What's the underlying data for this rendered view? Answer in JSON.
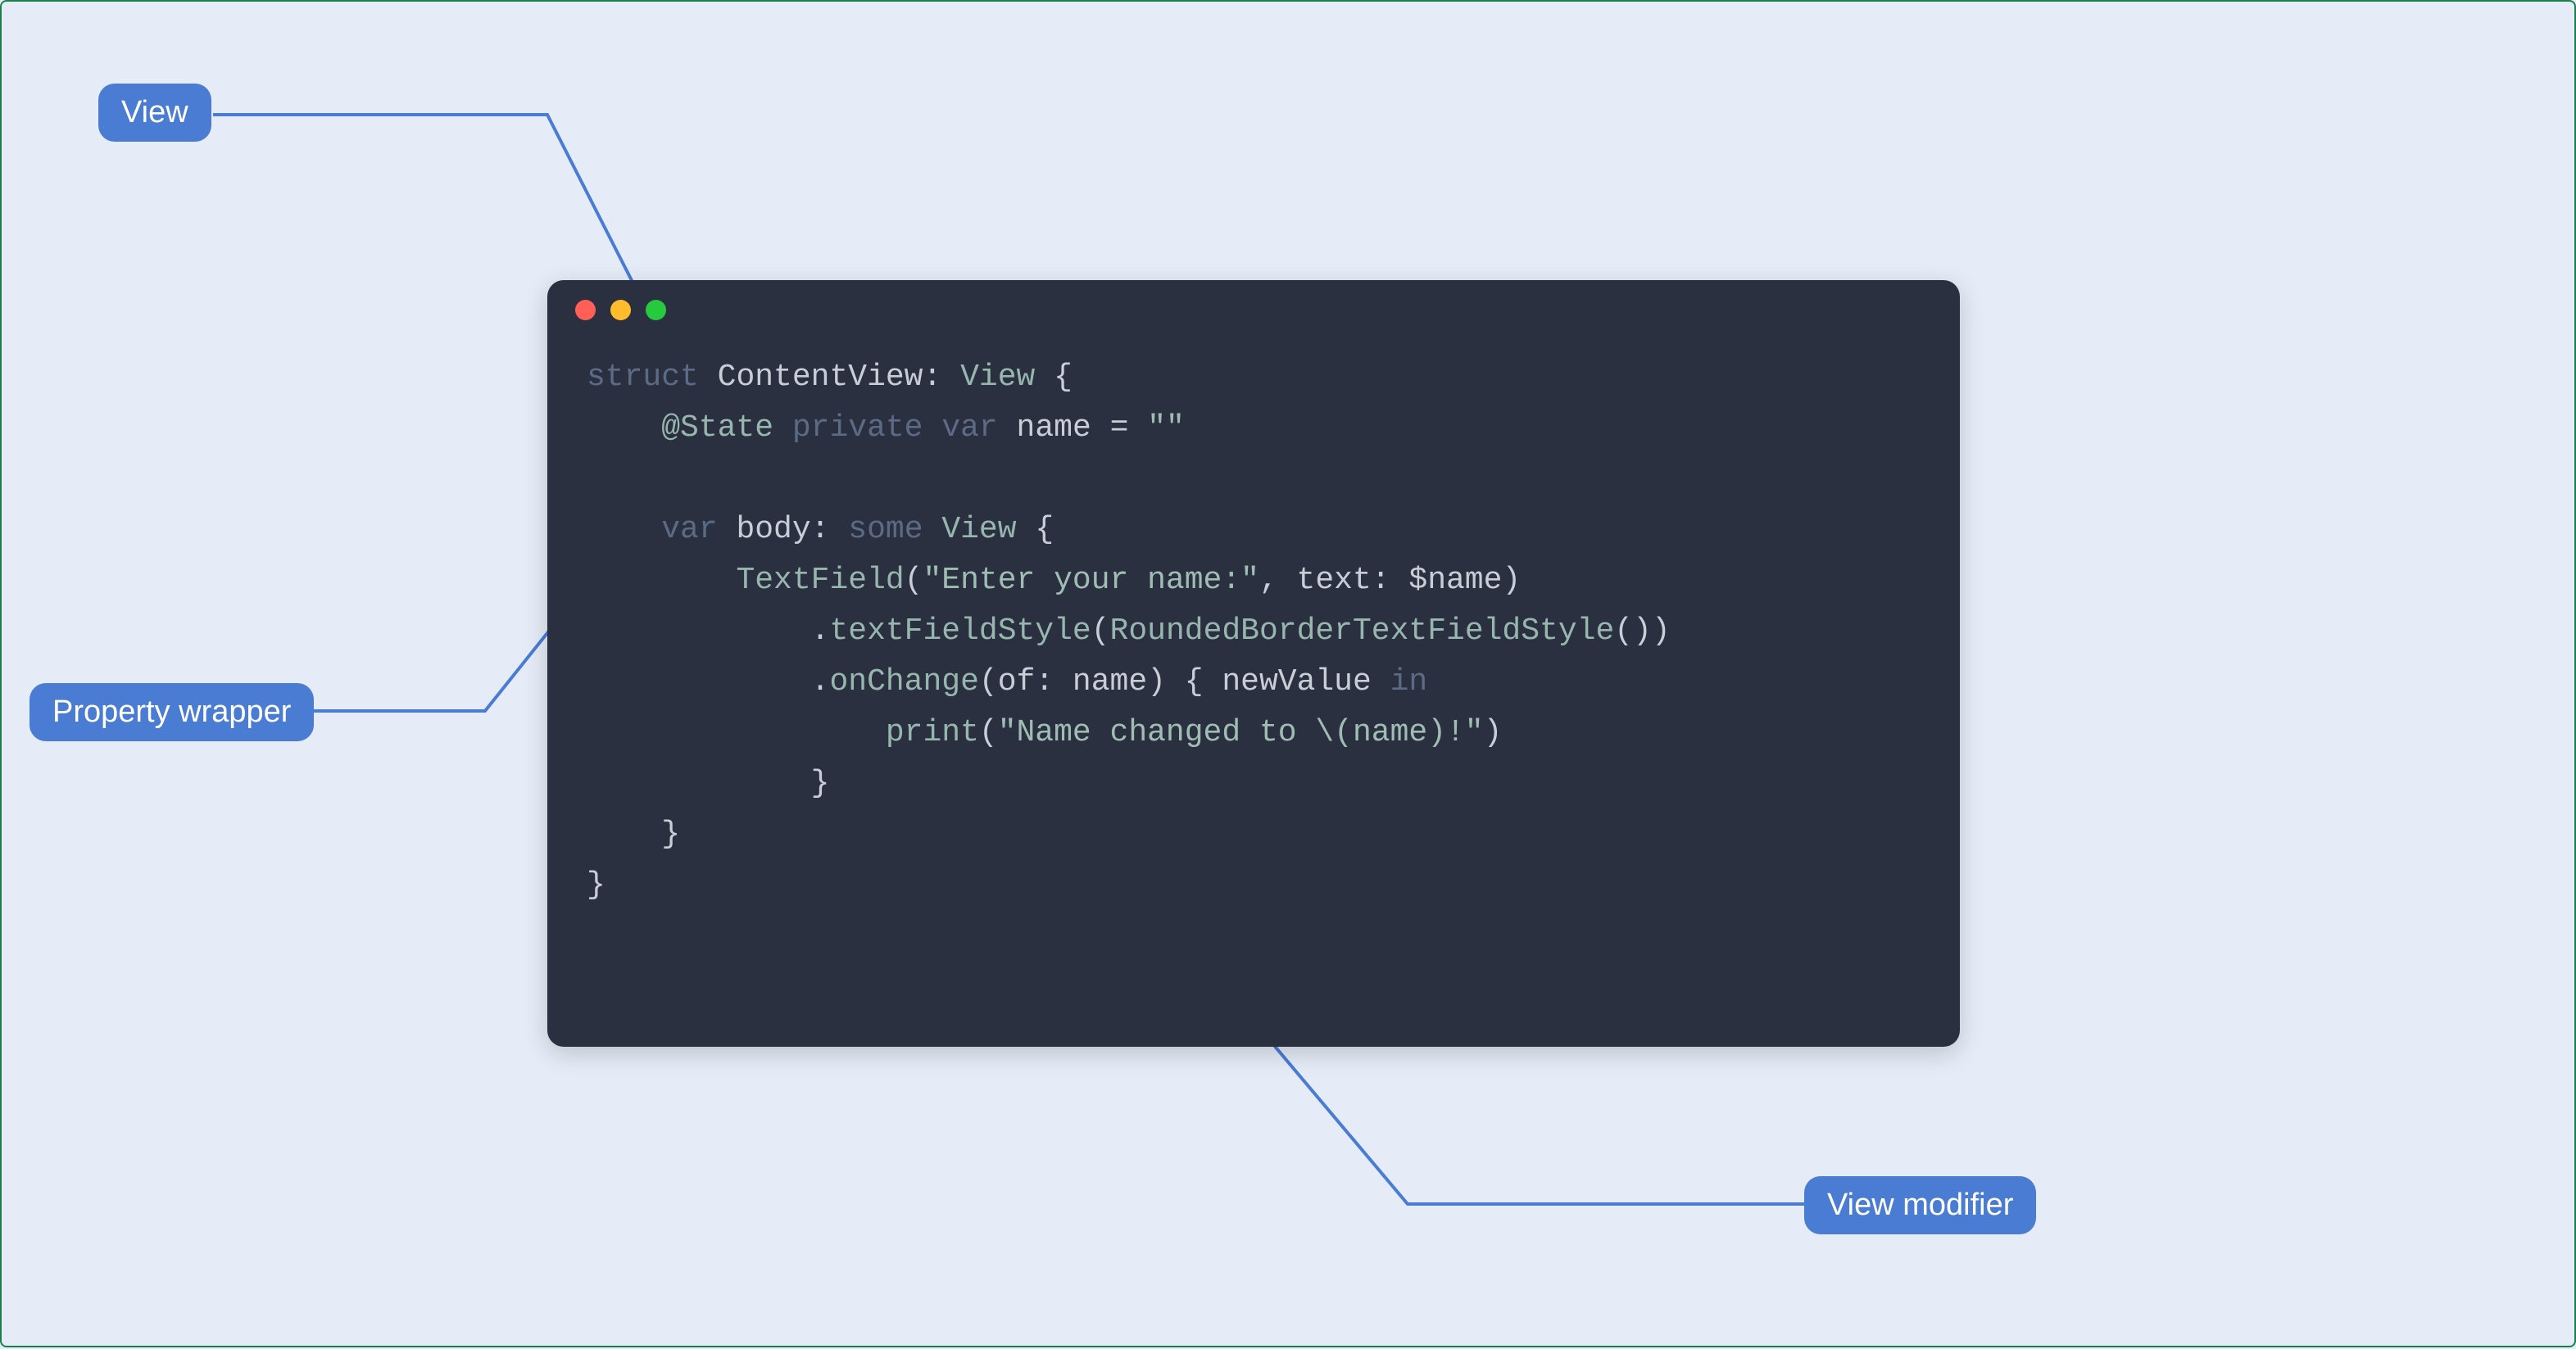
{
  "labels": {
    "view": "View",
    "propertyWrapper": "Property wrapper",
    "viewModifier": "View modifier"
  },
  "code": {
    "l1": {
      "kw1": "struct",
      "sp1": " ",
      "id1": "ContentView:",
      "sp2": " ",
      "type1": "View",
      "sp3": " {"
    },
    "l2": {
      "indent": "    ",
      "attr": "@State",
      "sp1": " ",
      "kw1": "private",
      "sp2": " ",
      "kw2": "var",
      "sp3": " ",
      "id": "name",
      "sp4": " = ",
      "str": "\"\""
    },
    "l3": {
      "text": ""
    },
    "l4": {
      "indent": "    ",
      "kw": "var",
      "sp1": " ",
      "id": "body:",
      "sp2": " ",
      "kw2": "some",
      "sp3": " ",
      "type": "View",
      "sp4": " {"
    },
    "l5": {
      "indent": "        ",
      "type": "TextField",
      "p1": "(",
      "str": "\"Enter your name:\"",
      "p2": ", text: ",
      "arg": "$name",
      "p3": ")"
    },
    "l6": {
      "indent": "            ",
      "dot": ".",
      "meth": "textFieldStyle",
      "p1": "(",
      "type": "RoundedBorderTextFieldStyle",
      "p2": "())"
    },
    "l7": {
      "indent": "            ",
      "dot": ".",
      "meth": "onChange",
      "p1": "(of: name) { newValue ",
      "kw": "in"
    },
    "l8": {
      "indent": "                ",
      "fn": "print",
      "p1": "(",
      "str": "\"Name changed to \\(name)!\"",
      "p2": ")"
    },
    "l9": {
      "indent": "            }",
      "text": ""
    },
    "l10": {
      "indent": "    }",
      "text": ""
    },
    "l11": {
      "indent": "}",
      "text": ""
    }
  }
}
